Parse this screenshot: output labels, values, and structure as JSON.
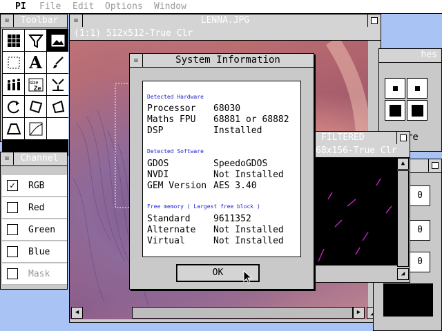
{
  "menubar": {
    "app": "PI",
    "items": [
      "File",
      "Edit",
      "Options",
      "Window"
    ]
  },
  "toolbar": {
    "title": "Toolbar"
  },
  "channel": {
    "title": "Channel",
    "items": [
      {
        "label": "RGB",
        "checked": true
      },
      {
        "label": "Red",
        "checked": false
      },
      {
        "label": "Green",
        "checked": false
      },
      {
        "label": "Blue",
        "checked": false
      },
      {
        "label": "Mask",
        "checked": false,
        "disabled": true
      }
    ]
  },
  "image_window": {
    "title": "LENNA.JPG",
    "info": "(1:1) 512x512-True Clr"
  },
  "swatches": {
    "title": "hes",
    "partial_text": "re"
  },
  "filtered_window": {
    "title": "FILTERED",
    "info": "68x156-True Clr"
  },
  "values_window": {
    "values": [
      "0",
      "0",
      "0"
    ]
  },
  "dialog": {
    "title": "System Information",
    "hardware": {
      "heading": "Detected Hardware",
      "rows": [
        {
          "key": "Processor",
          "value": "68030"
        },
        {
          "key": "Maths FPU",
          "value": "68881 or 68882"
        },
        {
          "key": "DSP",
          "value": "Installed"
        }
      ]
    },
    "software": {
      "heading": "Detected Software",
      "rows": [
        {
          "key": "GDOS",
          "value": "SpeedoGDOS"
        },
        {
          "key": "NVDI",
          "value": "Not Installed"
        },
        {
          "key": "GEM Version",
          "value": "AES 3.40"
        }
      ]
    },
    "memory": {
      "heading": "Free memory ( Largest free block )",
      "rows": [
        {
          "key": "Standard",
          "value": "9611352"
        },
        {
          "key": "Alternate",
          "value": "Not Installed"
        },
        {
          "key": "Virtual",
          "value": "Not Installed"
        }
      ]
    },
    "ok_label": "OK"
  },
  "colors": {
    "desktop": "#a9c3f4",
    "window": "#c9c9c9",
    "titlebar": "#d4d4d4",
    "section_heading": "#2020d0"
  },
  "icons": {
    "closer": "close-box-icon",
    "fuller": "full-box-icon",
    "cursor": "mouse-pointer-icon"
  }
}
